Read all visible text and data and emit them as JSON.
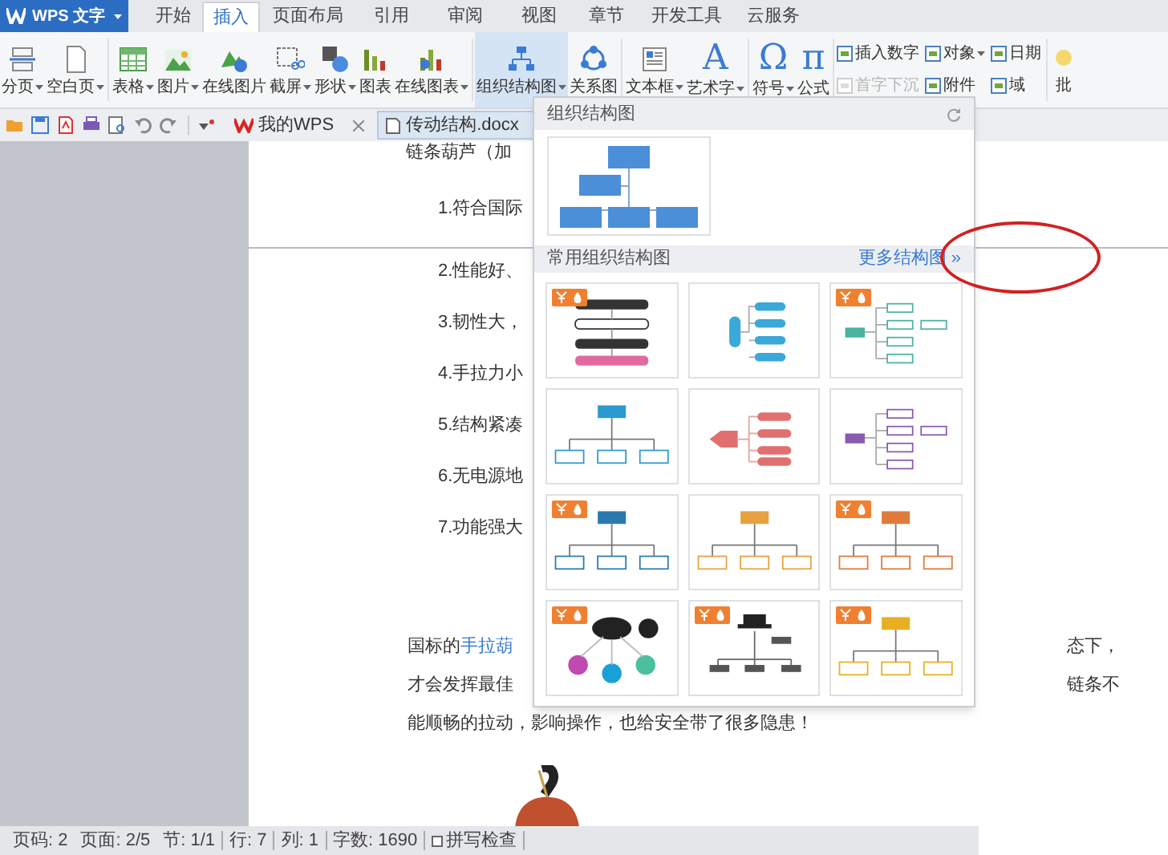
{
  "app_button": {
    "label": "WPS 文字"
  },
  "menu_tabs": [
    {
      "label": "开始",
      "selected": false
    },
    {
      "label": "插入",
      "selected": true
    },
    {
      "label": "页面布局",
      "selected": false
    },
    {
      "label": "引用",
      "selected": false
    },
    {
      "label": "审阅",
      "selected": false
    },
    {
      "label": "视图",
      "selected": false
    },
    {
      "label": "章节",
      "selected": false
    },
    {
      "label": "开发工具",
      "selected": false
    },
    {
      "label": "云服务",
      "selected": false
    }
  ],
  "ribbon": {
    "large_buttons": [
      {
        "label": "分页",
        "menu": true,
        "selected": false
      },
      {
        "label": "空白页",
        "menu": true,
        "selected": false
      },
      {
        "label": "表格",
        "menu": true,
        "selected": false
      },
      {
        "label": "图片",
        "menu": true,
        "selected": false
      },
      {
        "label": "在线图片",
        "menu": false,
        "selected": false
      },
      {
        "label": "截屏",
        "menu": true,
        "selected": false
      },
      {
        "label": "形状",
        "menu": true,
        "selected": false
      },
      {
        "label": "图表",
        "menu": false,
        "selected": false
      },
      {
        "label": "在线图表",
        "menu": true,
        "selected": false
      },
      {
        "label": "组织结构图",
        "menu": true,
        "selected": true
      },
      {
        "label": "关系图",
        "menu": false,
        "selected": false
      },
      {
        "label": "文本框",
        "menu": true,
        "selected": false
      },
      {
        "label": "艺术字",
        "menu": true,
        "selected": false,
        "glyph": "A"
      },
      {
        "label": "符号",
        "menu": true,
        "selected": false,
        "glyph": "Ω"
      },
      {
        "label": "公式",
        "menu": false,
        "selected": false,
        "glyph": "π"
      }
    ],
    "small_buttons": [
      {
        "label": "插入数字",
        "menu": false,
        "disabled": false
      },
      {
        "label": "首字下沉",
        "menu": false,
        "disabled": true
      },
      {
        "label": "对象",
        "menu": true,
        "disabled": false
      },
      {
        "label": "附件",
        "menu": false,
        "disabled": false
      },
      {
        "label": "日期",
        "menu": false,
        "disabled": false
      },
      {
        "label": "域",
        "menu": false,
        "disabled": false
      }
    ],
    "cut_button": {
      "label": "批"
    }
  },
  "doc_tabs": [
    {
      "label": "我的WPS",
      "selected": false
    },
    {
      "label": "传动结构.docx",
      "selected": true
    }
  ],
  "document": {
    "heading": "链条葫芦（加",
    "list_items": [
      "1.符合国际",
      "2.性能好、",
      "3.韧性大，",
      "4.手拉力小",
      "5.结构紧凑",
      "6.无电源地",
      "7.功能强大"
    ],
    "paragraph_lines": [
      {
        "left": "国标的",
        "link": "手拉葫",
        "right": "态下，"
      },
      {
        "left": "才会发挥最佳",
        "right": "链条不"
      },
      {
        "left": "能顺畅的拉动，影响操作，也给安全带了很多隐患！"
      }
    ]
  },
  "org_panel": {
    "title": "组织结构图",
    "section_title": "常用组织结构图",
    "more_link": "更多结构图 »",
    "templates": [
      {
        "kind": "vertical",
        "badge": true
      },
      {
        "kind": "pills",
        "badge": false
      },
      {
        "kind": "branches",
        "badge": true
      },
      {
        "kind": "tree",
        "badge": false
      },
      {
        "kind": "arrows",
        "badge": false
      },
      {
        "kind": "branches",
        "badge": false
      },
      {
        "kind": "tree",
        "badge": true
      },
      {
        "kind": "tree",
        "badge": false
      },
      {
        "kind": "tree",
        "badge": true
      },
      {
        "kind": "bubbles",
        "badge": true
      },
      {
        "kind": "hats",
        "badge": true
      },
      {
        "kind": "tree",
        "badge": true
      }
    ]
  },
  "status_bar": {
    "items": [
      "页码: 2",
      "页面: 2/5",
      "节: 1/1",
      "行: 7",
      "列: 1",
      "字数: 1690"
    ],
    "spell_check": {
      "label": "拼写检查",
      "checked": false
    }
  }
}
